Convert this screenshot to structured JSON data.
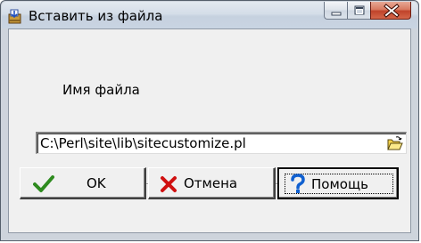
{
  "window": {
    "title": "Вставить из файла",
    "controls": {
      "minimize_icon": "minimize-icon",
      "maximize_icon": "maximize-icon",
      "close_icon": "close-icon"
    }
  },
  "form": {
    "filename_label": "Имя файла",
    "filename_value": "C:\\Perl\\site\\lib\\sitecustomize.pl",
    "browse_icon": "folder-open-icon"
  },
  "buttons": {
    "ok": "OK",
    "cancel": "Отмена",
    "help": "Помощь"
  },
  "colors": {
    "ok_check": "#2e8b1f",
    "cancel_x": "#d01010",
    "help_q": "#1060d0",
    "close_button": "#c0432a"
  }
}
